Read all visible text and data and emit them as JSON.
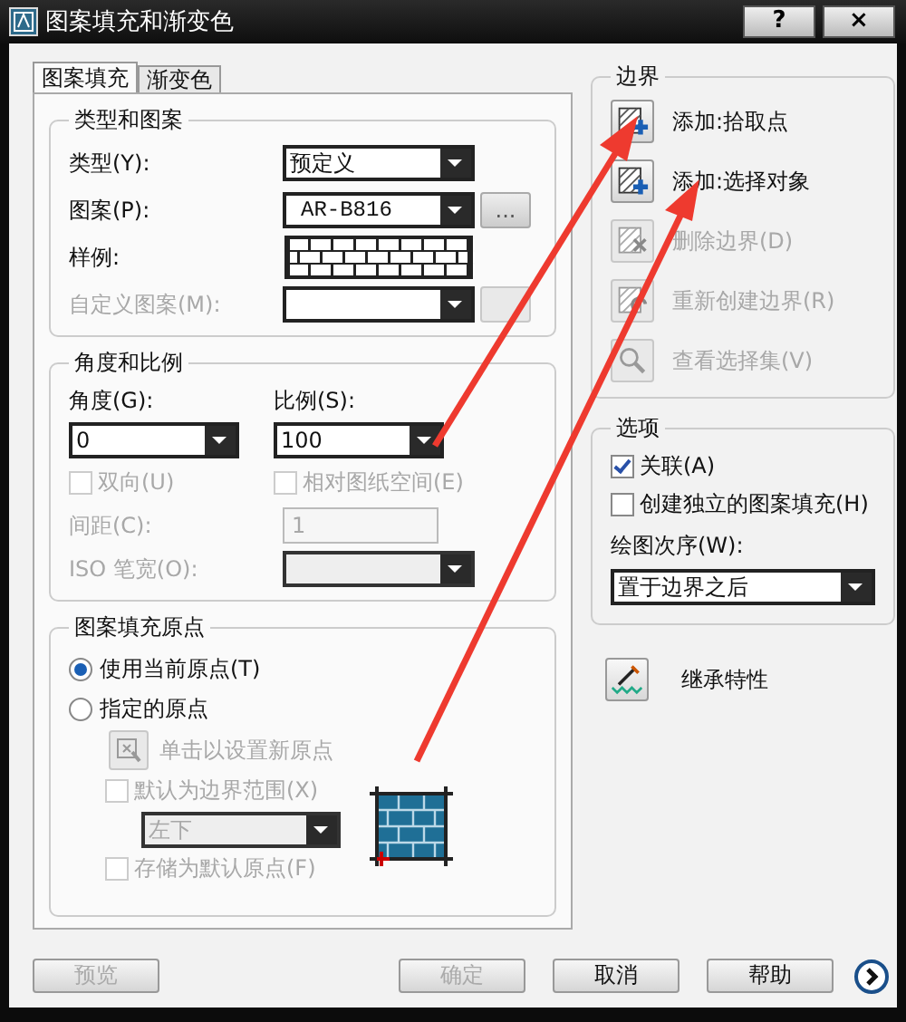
{
  "window": {
    "title": "图案填充和渐变色",
    "help_button": "?",
    "close_button": "×"
  },
  "tabs": [
    {
      "label": "图案填充",
      "selected": true
    },
    {
      "label": "渐变色",
      "selected": false
    }
  ],
  "pattern_group": {
    "title": "类型和图案",
    "type": {
      "label": "类型(Y):",
      "value": "预定义"
    },
    "pattern": {
      "label": "图案(P):",
      "value": "AR-B816",
      "browse_button": "..."
    },
    "sample": {
      "label": "样例:"
    },
    "custom_pattern": {
      "label": "自定义图案(M):",
      "disabled": true
    }
  },
  "angle_group": {
    "title": "角度和比例",
    "angle": {
      "label": "角度(G):",
      "value": "0"
    },
    "scale": {
      "label": "比例(S):",
      "value": "100"
    },
    "double": {
      "label": "双向(U)",
      "checked": false,
      "disabled": true
    },
    "relative": {
      "label": "相对图纸空间(E)",
      "checked": false,
      "disabled": true
    },
    "spacing": {
      "label": "间距(C):",
      "value": "1",
      "disabled": true
    },
    "iso_pen": {
      "label": "ISO 笔宽(O):",
      "disabled": true
    }
  },
  "origin_group": {
    "title": "图案填充原点",
    "options": [
      {
        "label": "使用当前原点(T)",
        "selected": true
      },
      {
        "label": "指定的原点",
        "selected": false
      }
    ],
    "click_set": {
      "label": "单击以设置新原点",
      "disabled": true
    },
    "default_extent": {
      "label": "默认为边界范围(X)",
      "checked": false,
      "disabled": true
    },
    "position": {
      "value": "左下",
      "disabled": true
    },
    "store_default": {
      "label": "存储为默认原点(F)",
      "checked": false,
      "disabled": true
    }
  },
  "boundary_group": {
    "title": "边界",
    "buttons": [
      {
        "label": "添加:拾取点",
        "disabled": false,
        "kind": "pick"
      },
      {
        "label": "添加:选择对象",
        "disabled": false,
        "kind": "select"
      },
      {
        "label": "删除边界(D)",
        "disabled": true,
        "kind": "remove"
      },
      {
        "label": "重新创建边界(R)",
        "disabled": true,
        "kind": "recreate"
      },
      {
        "label": "查看选择集(V)",
        "disabled": true,
        "kind": "view"
      }
    ]
  },
  "options_group": {
    "title": "选项",
    "checkboxes": [
      {
        "label": "关联(A)",
        "checked": true
      },
      {
        "label": "创建独立的图案填充(H)",
        "checked": false
      }
    ],
    "draw_order": {
      "label": "绘图次序(W):",
      "value": "置于边界之后"
    }
  },
  "inherit": {
    "label": "继承特性"
  },
  "footer_buttons": [
    {
      "label": "预览",
      "disabled": true
    },
    {
      "label": "确定",
      "disabled": true
    },
    {
      "label": "取消",
      "disabled": false
    },
    {
      "label": "帮助",
      "disabled": false
    }
  ]
}
